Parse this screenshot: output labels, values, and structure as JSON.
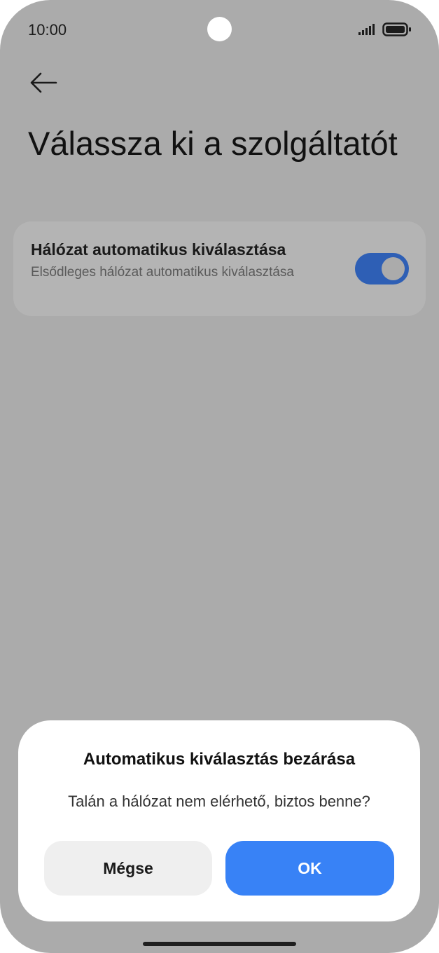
{
  "status_bar": {
    "time": "10:00",
    "icons": [
      "signal-icon",
      "battery-icon"
    ]
  },
  "header": {
    "back_icon": "arrow-left-icon",
    "title": "Válassza ki a szolgáltatót"
  },
  "setting": {
    "title": "Hálózat automatikus kiválasztása",
    "subtitle": "Elsődleges hálózat automatikus kiválasztása",
    "toggle_on": true
  },
  "dialog": {
    "title": "Automatikus kiválasztás bezárása",
    "message": "Talán a hálózat nem elérhető, biztos benne?",
    "cancel_label": "Mégse",
    "ok_label": "OK"
  },
  "colors": {
    "overlay": "#ababab",
    "toggle_active": "#2e5fb5",
    "ok_button": "#3882f6",
    "cancel_button": "#efefef"
  }
}
